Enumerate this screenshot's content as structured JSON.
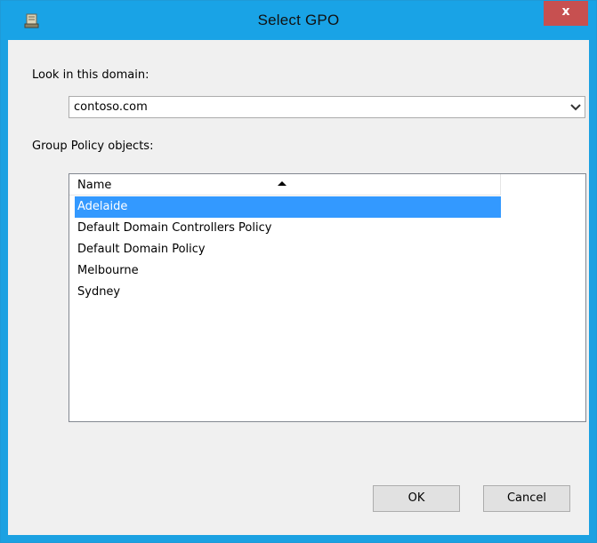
{
  "window": {
    "title": "Select GPO",
    "close_label": "x",
    "accent_color": "#19a3e6",
    "close_color": "#c75050"
  },
  "domain": {
    "label": "Look in this domain:",
    "value": "contoso.com"
  },
  "gpo_list": {
    "label": "Group Policy objects:",
    "column_header": "Name",
    "sort": "ascending",
    "selected_color": "#3399ff",
    "items": [
      {
        "name": "Adelaide",
        "selected": true
      },
      {
        "name": "Default Domain Controllers Policy",
        "selected": false
      },
      {
        "name": "Default Domain Policy",
        "selected": false
      },
      {
        "name": "Melbourne",
        "selected": false
      },
      {
        "name": "Sydney",
        "selected": false
      }
    ]
  },
  "buttons": {
    "ok_label": "OK",
    "cancel_label": "Cancel"
  }
}
